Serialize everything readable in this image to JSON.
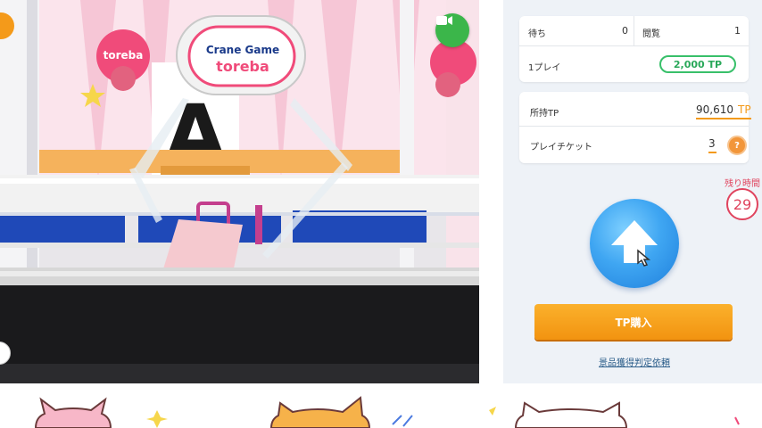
{
  "status_card": {
    "waiting_label": "待ち",
    "waiting_value": "0",
    "viewers_label": "閲覧",
    "viewers_value": "1",
    "per_play_label": "1プレイ",
    "per_play_price": "2,000 TP"
  },
  "balance_card": {
    "owned_label": "所持TP",
    "owned_value": "90,610",
    "owned_unit": "TP",
    "ticket_label": "プレイチケット",
    "ticket_value": "3",
    "help_label": "?"
  },
  "timer": {
    "label": "残り時間",
    "seconds": "29"
  },
  "actions": {
    "buy_label": "TP購入",
    "judge_link": "景品獲得判定依頼"
  },
  "camera": {
    "sign_line1": "Crane Game",
    "sign_line2": "toreba",
    "letter": "A"
  },
  "icons": {
    "left": "camera-left-icon",
    "switch": "camera-switch-icon",
    "up": "up-arrow-icon",
    "help": "help-icon"
  },
  "colors": {
    "accent_orange": "#f39a1a",
    "tp_green": "#38c06a",
    "timer_red": "#e0445e",
    "up_blue": "#3fa6f2"
  }
}
